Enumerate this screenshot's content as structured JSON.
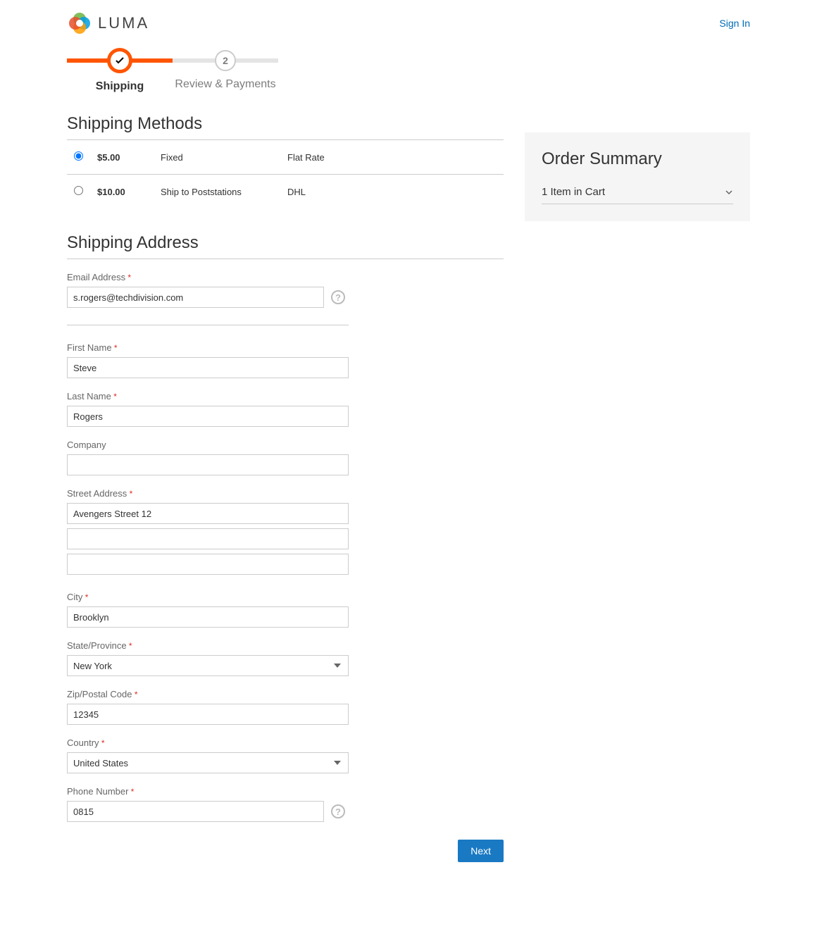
{
  "header": {
    "brand": "LUMA",
    "signin": "Sign In"
  },
  "progress": {
    "step1_label": "Shipping",
    "step2_number": "2",
    "step2_label": "Review & Payments"
  },
  "shipping_methods": {
    "title": "Shipping Methods",
    "rows": [
      {
        "price": "$5.00",
        "method": "Fixed",
        "carrier": "Flat Rate",
        "selected": true
      },
      {
        "price": "$10.00",
        "method": "Ship to Poststations",
        "carrier": "DHL",
        "selected": false
      }
    ]
  },
  "shipping_address": {
    "title": "Shipping Address",
    "labels": {
      "email": "Email Address",
      "first_name": "First Name",
      "last_name": "Last Name",
      "company": "Company",
      "street": "Street Address",
      "city": "City",
      "state": "State/Province",
      "zip": "Zip/Postal Code",
      "country": "Country",
      "phone": "Phone Number"
    },
    "values": {
      "email": "s.rogers@techdivision.com",
      "first_name": "Steve",
      "last_name": "Rogers",
      "company": "",
      "street1": "Avengers Street 12",
      "street2": "",
      "street3": "",
      "city": "Brooklyn",
      "state": "New York",
      "zip": "12345",
      "country": "United States",
      "phone": "0815"
    }
  },
  "summary": {
    "title": "Order Summary",
    "cart_line": "1 Item in Cart"
  },
  "actions": {
    "next": "Next"
  }
}
